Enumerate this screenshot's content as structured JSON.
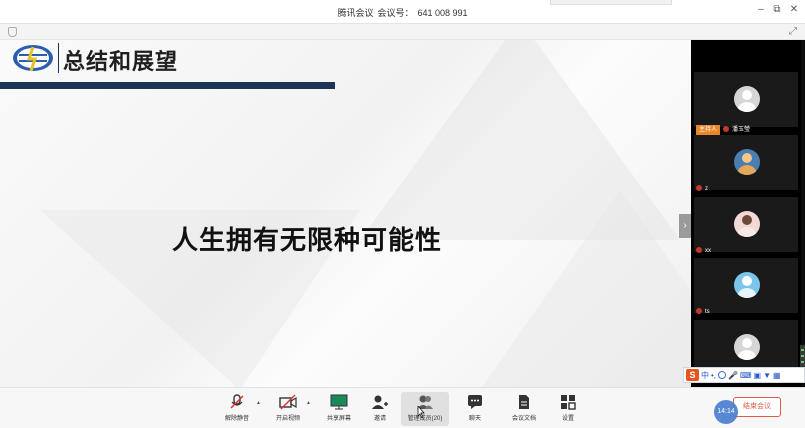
{
  "window": {
    "app_name": "腾讯会议",
    "meeting_id_label": "会议号：",
    "meeting_id": "641 008 991"
  },
  "slide": {
    "title": "总结和展望",
    "main_text": "人生拥有无限种可能性"
  },
  "participants": [
    {
      "name": "潘玉瑩",
      "badge": "主持人"
    },
    {
      "name": "z",
      "badge": ""
    },
    {
      "name": "xx",
      "badge": ""
    },
    {
      "name": "ts",
      "badge": ""
    },
    {
      "name": "",
      "badge": ""
    }
  ],
  "ime_bar": {
    "mode": "中"
  },
  "toolbar": {
    "unmute": "解除静音",
    "video": "开启视频",
    "share": "共享屏幕",
    "invite": "邀请",
    "members": "管理成员(20)",
    "chat": "聊天",
    "docs": "会议文档",
    "settings": "设置",
    "leave": "结束会议",
    "time": "14:14"
  },
  "colors": {
    "accent_navy": "#1b3556",
    "leave_red": "#e25b4b",
    "host_orange": "#e8872a"
  }
}
